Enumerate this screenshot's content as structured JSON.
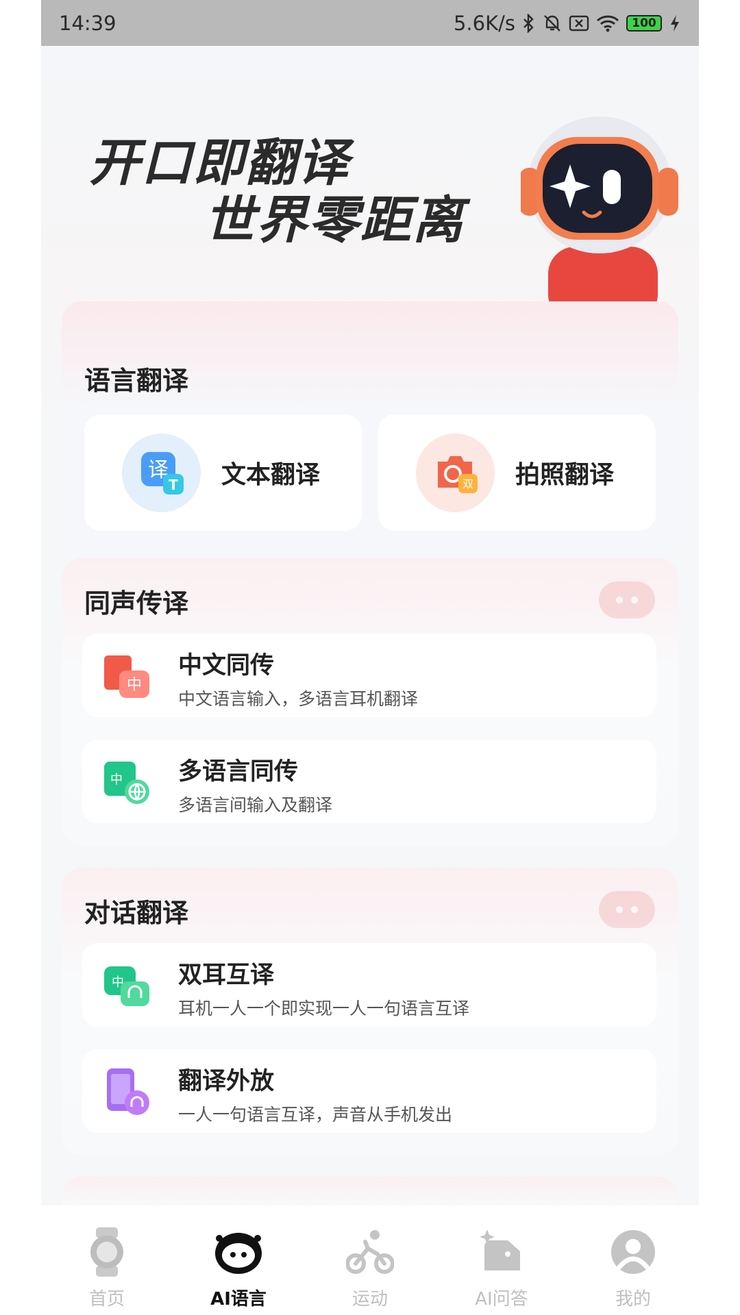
{
  "status_bar": {
    "time": "14:39",
    "speed": "5.6K/s",
    "battery": "100"
  },
  "hero": {
    "line1": "开口即翻译",
    "line2": "世界零距离"
  },
  "language_translation": {
    "title": "语言翻译",
    "items": [
      {
        "label": "文本翻译",
        "icon": "text-translate-icon"
      },
      {
        "label": "拍照翻译",
        "icon": "camera-translate-icon"
      }
    ]
  },
  "simultaneous": {
    "title": "同声传译",
    "items": [
      {
        "title": "中文同传",
        "desc": "中文语言输入，多语言耳机翻译",
        "icon": "chinese-simultaneous-icon"
      },
      {
        "title": "多语言同传",
        "desc": "多语言间输入及翻译",
        "icon": "multilingual-simultaneous-icon"
      }
    ]
  },
  "dialogue": {
    "title": "对话翻译",
    "items": [
      {
        "title": "双耳互译",
        "desc": "耳机一人一个即实现一人一句语言互译",
        "icon": "dual-earbud-icon"
      },
      {
        "title": "翻译外放",
        "desc": "一人一句语言互译，声音从手机发出",
        "icon": "speaker-translate-icon"
      }
    ]
  },
  "tabs": [
    {
      "label": "首页",
      "icon": "watch-icon"
    },
    {
      "label": "AI语言",
      "icon": "robot-icon",
      "active": true
    },
    {
      "label": "运动",
      "icon": "cycling-icon"
    },
    {
      "label": "AI问答",
      "icon": "chat-bot-icon"
    },
    {
      "label": "我的",
      "icon": "profile-icon"
    }
  ],
  "colors": {
    "accent": "#d5202f",
    "tab_inactive": "#bfbfbf",
    "text_primary": "#222222"
  }
}
